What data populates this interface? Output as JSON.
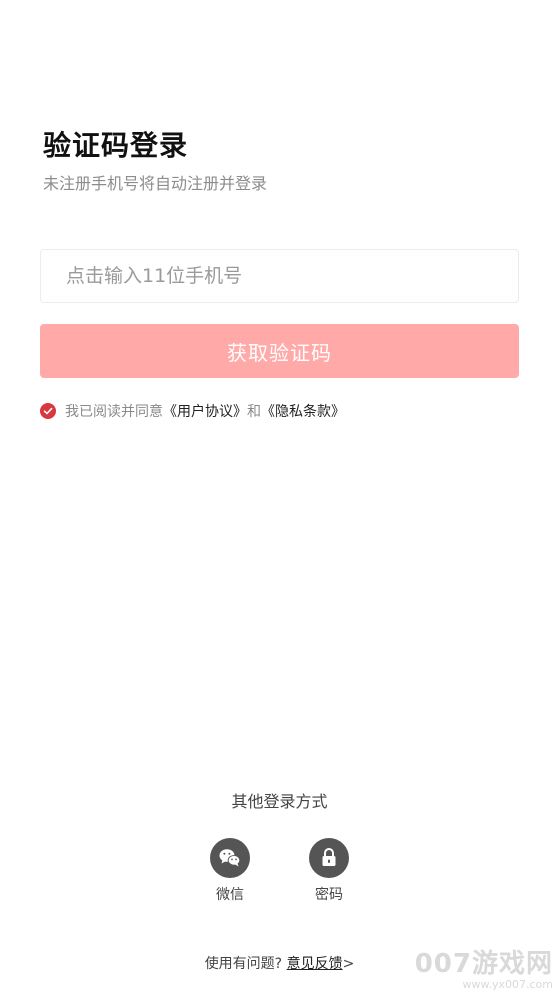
{
  "header": {
    "title": "验证码登录",
    "subtitle": "未注册手机号将自动注册并登录"
  },
  "form": {
    "phone_placeholder": "点击输入11位手机号",
    "phone_value": "",
    "get_code_label": "获取验证码"
  },
  "agreement": {
    "checked": true,
    "prefix": "我已阅读并同意",
    "user_agreement": "《用户协议》",
    "connector": "和",
    "privacy_policy": "《隐私条款》"
  },
  "other_login": {
    "title": "其他登录方式",
    "options": [
      {
        "label": "微信",
        "icon": "wechat-icon"
      },
      {
        "label": "密码",
        "icon": "lock-icon"
      }
    ]
  },
  "footer": {
    "question": "使用有问题? ",
    "feedback_link": "意见反馈",
    "arrow": ">"
  },
  "watermark": {
    "brand": "007游戏网",
    "url": "www.yx007.com"
  },
  "colors": {
    "button_bg": "#ffaaa8",
    "check_red": "#d8373f",
    "icon_gray": "#555555"
  }
}
